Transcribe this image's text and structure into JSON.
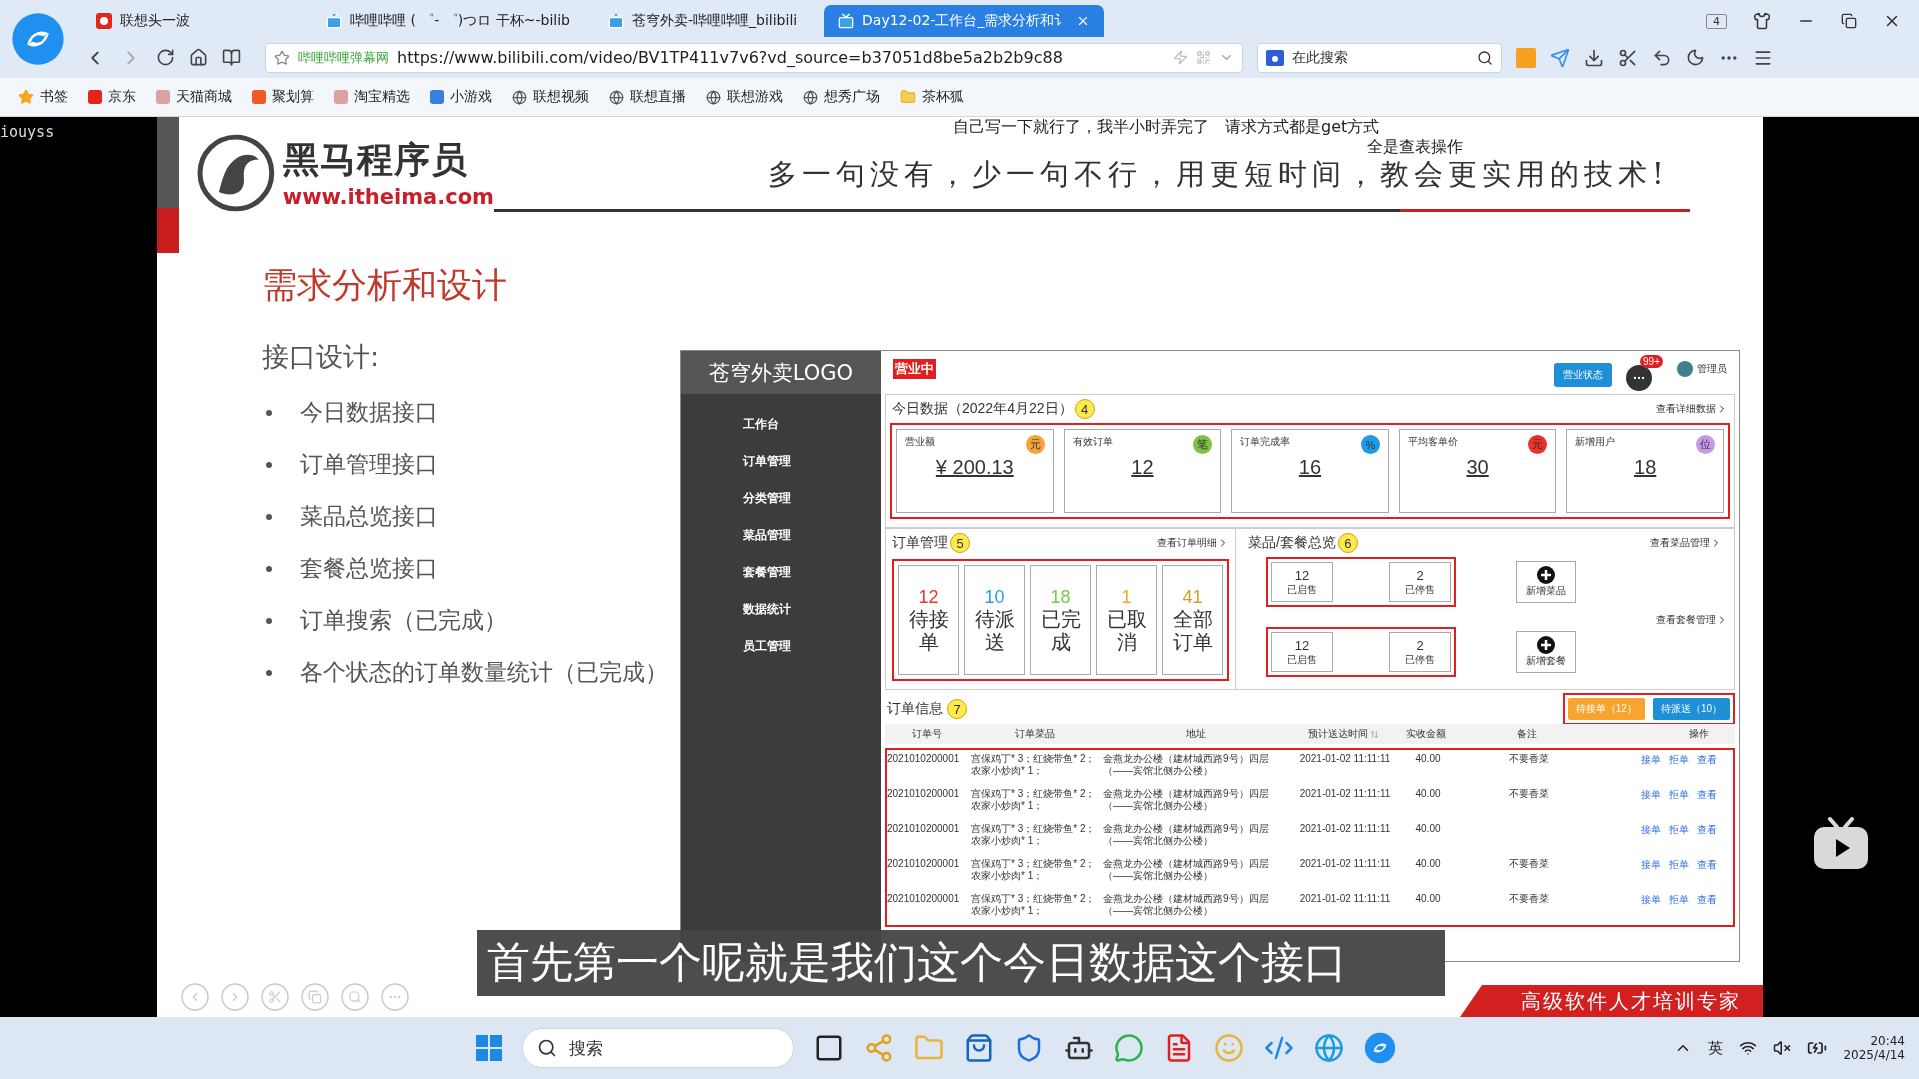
{
  "browser": {
    "tabs": [
      {
        "label": "联想头一波",
        "selected": false,
        "kind": "lenovo"
      },
      {
        "label": "哔哩哔哩 ( ゜- ゜)つロ 干杯~-bilib",
        "selected": false,
        "kind": "bilibili"
      },
      {
        "label": "苍穹外卖-哔哩哔哩_bilibili",
        "selected": false,
        "kind": "bilibili"
      },
      {
        "label": "Day12-02-工作台_需求分析和讠",
        "selected": true,
        "kind": "bilibili"
      }
    ],
    "tab_count": "4",
    "site_label": "哔哩哔哩弹幕网",
    "url": "https://www.bilibili.com/video/BV1TP411v7v6?vd_source=b37051d8be5a2b2b9c88",
    "search_placeholder": "在此搜索",
    "bookmarks": [
      {
        "label": "书签",
        "kind": "star"
      },
      {
        "label": "京东",
        "kind": "badge",
        "color": "#e1251b"
      },
      {
        "label": "天猫商城",
        "kind": "badge",
        "color": "#d9a3a3"
      },
      {
        "label": "聚划算",
        "kind": "badge",
        "color": "#f05a22"
      },
      {
        "label": "淘宝精选",
        "kind": "badge",
        "color": "#d9a3a3"
      },
      {
        "label": "小游戏",
        "kind": "badge",
        "color": "#3a7fe0"
      },
      {
        "label": "联想视频",
        "kind": "globe"
      },
      {
        "label": "联想直播",
        "kind": "globe"
      },
      {
        "label": "联想游戏",
        "kind": "globe"
      },
      {
        "label": "想秀广场",
        "kind": "globe"
      },
      {
        "label": "茶杯狐",
        "kind": "folder"
      }
    ]
  },
  "video": {
    "user_tag": "iouyss",
    "subtitle": "首先第一个呢就是我们这个今日数据这个接口",
    "slide": {
      "brand": "黑马程序员",
      "brand_url": "www.itheima.com",
      "annotations": [
        "自己写一下就行了，我半小时弄完了　请求方式都是get方式",
        "全是查表操作"
      ],
      "slogan": "多一句没有，少一句不行，用更短时间，教会更实用的技术!",
      "title": "需求分析和设计",
      "section": "接口设计:",
      "bullets": [
        "今日数据接口",
        "订单管理接口",
        "菜品总览接口",
        "套餐总览接口",
        "订单搜索（已完成）",
        "各个状态的订单数量统计（已完成）"
      ],
      "banner": "高级软件人才培训专家",
      "dashboard": {
        "logo": "苍穹外卖LOGO",
        "status_badge": "营业中",
        "status_button": "营业状态",
        "message_count": "99+",
        "user": "管理员",
        "nav": [
          "工作台",
          "订单管理",
          "分类管理",
          "菜品管理",
          "套餐管理",
          "数据统计",
          "员工管理"
        ],
        "today": {
          "title": "今日数据（2022年4月22日）",
          "badge": "4",
          "link": "查看详细数据",
          "cards": [
            {
              "label": "营业额",
              "icon": "元",
              "color": "#f5a33b",
              "value": "¥ 200.13"
            },
            {
              "label": "有效订单",
              "icon": "笔",
              "color": "#7dc242",
              "value": "12"
            },
            {
              "label": "订单完成率",
              "icon": "%",
              "color": "#1e9be8",
              "value": "16"
            },
            {
              "label": "平均客单价",
              "icon": "元",
              "color": "#e8322c",
              "value": "30"
            },
            {
              "label": "新增用户",
              "icon": "位",
              "color": "#c59be8",
              "value": "18"
            }
          ]
        },
        "orders": {
          "title": "订单管理",
          "badge": "5",
          "link": "查看订单明细",
          "stats": [
            {
              "count": "12",
              "label": "待接单",
              "color": "#e8352e"
            },
            {
              "count": "10",
              "label": "待派送",
              "color": "#2d9ee0"
            },
            {
              "count": "18",
              "label": "已完成",
              "color": "#7ac943"
            },
            {
              "count": "1",
              "label": "已取消",
              "color": "#f5a623"
            },
            {
              "count": "41",
              "label": "全部订单",
              "color": "#c8a62a"
            }
          ]
        },
        "overview": {
          "title": "菜品/套餐总览",
          "badge": "6",
          "groups": [
            {
              "link": "查看菜品管理",
              "items": [
                {
                  "count": "12",
                  "label": "已启售"
                },
                {
                  "count": "2",
                  "label": "已停售"
                }
              ],
              "add": "新增菜品"
            },
            {
              "link": "查看套餐管理",
              "items": [
                {
                  "count": "12",
                  "label": "已启售"
                },
                {
                  "count": "2",
                  "label": "已停售"
                }
              ],
              "add": "新增套餐"
            }
          ]
        },
        "order_info": {
          "title": "订单信息",
          "badge": "7",
          "filters": [
            {
              "label": "待接单（12）",
              "color": "#f7a531"
            },
            {
              "label": "待派送（10）",
              "color": "#1d90d8"
            }
          ],
          "columns": [
            "订单号",
            "订单菜品",
            "地址",
            "预计送达时间",
            "实收金额",
            "备注",
            "操作"
          ],
          "rows": [
            {
              "id": "2021010200001",
              "dishes": "宫保鸡丁* 3；红烧带鱼* 2；农家小炒肉* 1；",
              "address": "金燕龙办公楼（建材城西路9号）四层（——宾馆北侧办公楼）",
              "time": "2021-01-02 11:11:11",
              "amount": "40.00",
              "note": "不要香菜",
              "actions": [
                "接单",
                "拒单",
                "查看"
              ]
            },
            {
              "id": "2021010200001",
              "dishes": "宫保鸡丁* 3；红烧带鱼* 2；农家小炒肉* 1；",
              "address": "金燕龙办公楼（建材城西路9号）四层（——宾馆北侧办公楼）",
              "time": "2021-01-02 11:11:11",
              "amount": "40.00",
              "note": "不要香菜",
              "actions": [
                "接单",
                "拒单",
                "查看"
              ]
            },
            {
              "id": "2021010200001",
              "dishes": "宫保鸡丁* 3；红烧带鱼* 2；农家小炒肉* 1；",
              "address": "金燕龙办公楼（建材城西路9号）四层（——宾馆北侧办公楼）",
              "time": "2021-01-02 11:11:11",
              "amount": "40.00",
              "actions": [
                "接单",
                "拒单",
                "查看"
              ]
            },
            {
              "id": "2021010200001",
              "dishes": "宫保鸡丁* 3；红烧带鱼* 2；农家小炒肉* 1；",
              "address": "金燕龙办公楼（建材城西路9号）四层（——宾馆北侧办公楼）",
              "time": "2021-01-02 11:11:11",
              "amount": "40.00",
              "note": "不要香菜",
              "actions": [
                "接单",
                "拒单",
                "查看"
              ]
            },
            {
              "id": "2021010200001",
              "dishes": "宫保鸡丁* 3；红烧带鱼* 2；农家小炒肉* 1；",
              "address": "金燕龙办公楼（建材城西路9号）四层（——宾馆北侧办公楼）",
              "time": "2021-01-02 11:11:11",
              "amount": "40.00",
              "note": "不要香菜",
              "actions": [
                "接单",
                "拒单",
                "查看"
              ]
            }
          ]
        }
      }
    }
  },
  "taskbar": {
    "search_placeholder": "搜索",
    "ime": "英",
    "time": "20:44",
    "date": "2025/4/14"
  }
}
